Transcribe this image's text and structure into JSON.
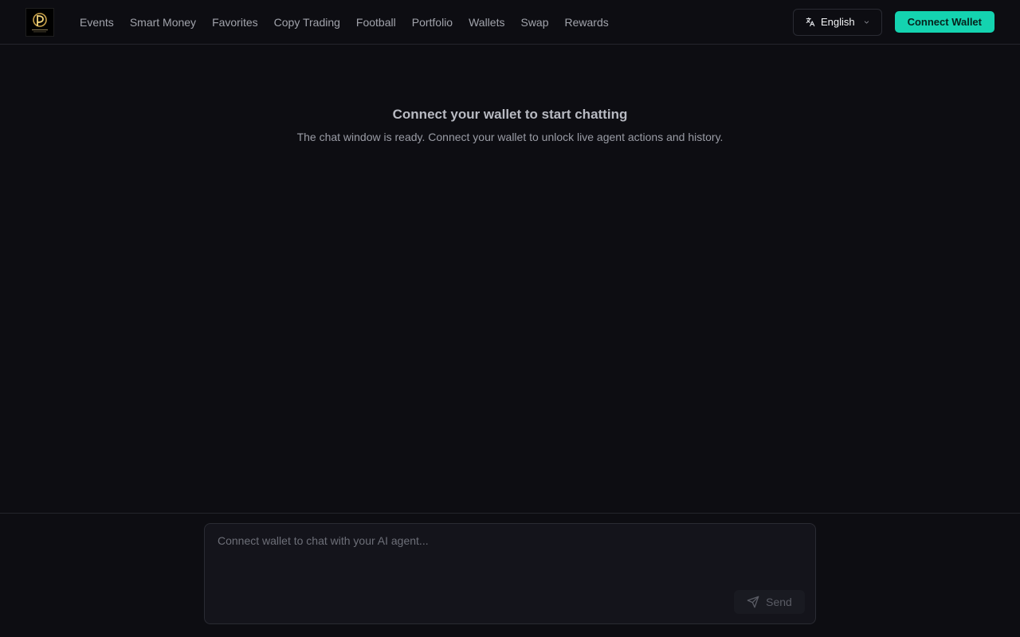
{
  "header": {
    "logo_icon": "logo-icon",
    "nav": [
      {
        "label": "Events"
      },
      {
        "label": "Smart Money"
      },
      {
        "label": "Favorites"
      },
      {
        "label": "Copy Trading"
      },
      {
        "label": "Football"
      },
      {
        "label": "Portfolio"
      },
      {
        "label": "Wallets"
      },
      {
        "label": "Swap"
      },
      {
        "label": "Rewards"
      }
    ],
    "language": {
      "label": "English",
      "icon": "translate-icon"
    },
    "connect_label": "Connect Wallet"
  },
  "main": {
    "title": "Connect your wallet to start chatting",
    "subtitle": "The chat window is ready. Connect your wallet to unlock live agent actions and history."
  },
  "composer": {
    "placeholder": "Connect wallet to chat with your AI agent...",
    "value": "",
    "send_label": "Send",
    "send_icon": "send-icon"
  },
  "colors": {
    "background": "#0d0d12",
    "accent": "#14d3b0",
    "border": "#24252c"
  }
}
